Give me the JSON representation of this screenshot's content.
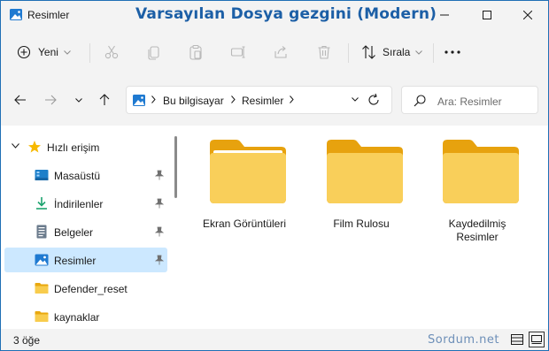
{
  "window": {
    "title": "Resimler",
    "overlay_caption": "Varsayılan Dosya gezgini (Modern)"
  },
  "commandbar": {
    "new_label": "Yeni",
    "sort_label": "Sırala",
    "icons": [
      "cut-icon",
      "copy-icon",
      "paste-icon",
      "rename-icon",
      "share-icon",
      "delete-icon"
    ]
  },
  "address": {
    "crumbs": [
      "Bu bilgisayar",
      "Resimler"
    ]
  },
  "search": {
    "placeholder": "Ara: Resimler"
  },
  "navigation": {
    "quick_access": "Hızlı erişim",
    "items": [
      {
        "label": "Masaüstü",
        "icon": "desktop-icon",
        "pinned": true
      },
      {
        "label": "İndirilenler",
        "icon": "download-icon",
        "pinned": true
      },
      {
        "label": "Belgeler",
        "icon": "documents-icon",
        "pinned": true
      },
      {
        "label": "Resimler",
        "icon": "pictures-icon",
        "pinned": true,
        "selected": true
      },
      {
        "label": "Defender_reset",
        "icon": "folder-icon",
        "pinned": false
      },
      {
        "label": "kaynaklar",
        "icon": "folder-icon",
        "pinned": false
      }
    ]
  },
  "folders": [
    {
      "label": "Ekran Görüntüleri"
    },
    {
      "label": "Film Rulosu"
    },
    {
      "label": "Kaydedilmiş Resimler"
    }
  ],
  "status": {
    "item_count": "3 öğe",
    "watermark": "Sordum.net"
  },
  "colors": {
    "accent": "#1c5fa6",
    "selection": "#cce8ff",
    "folder": "#f6c94e"
  }
}
